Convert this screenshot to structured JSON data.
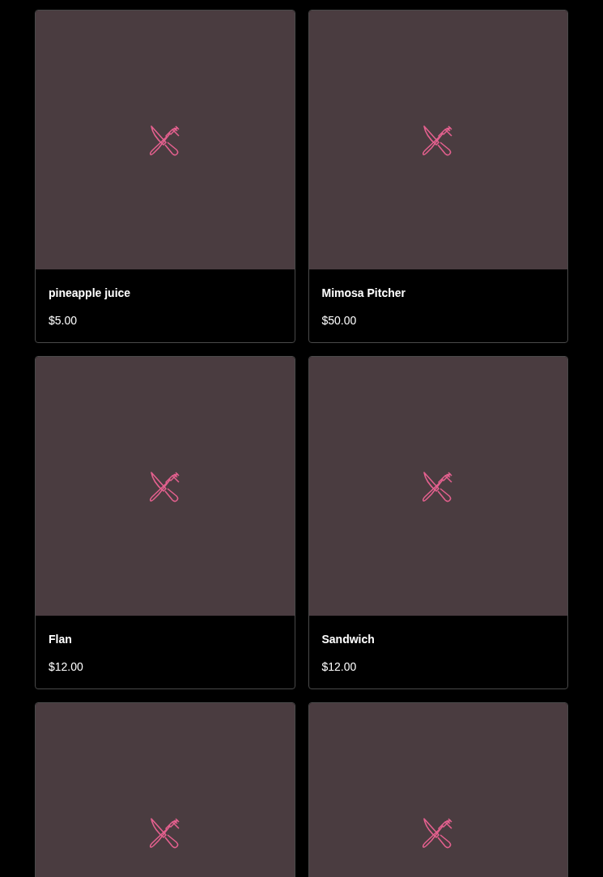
{
  "items": [
    {
      "kind": "product",
      "name": "pineapple juice",
      "price": "$5.00"
    },
    {
      "kind": "product",
      "name": "Mimosa Pitcher",
      "price": "$50.00"
    },
    {
      "kind": "product",
      "name": "Flan",
      "price": "$12.00"
    },
    {
      "kind": "product",
      "name": "Sandwich",
      "price": "$12.00"
    },
    {
      "kind": "image_only"
    },
    {
      "kind": "image_only"
    }
  ]
}
